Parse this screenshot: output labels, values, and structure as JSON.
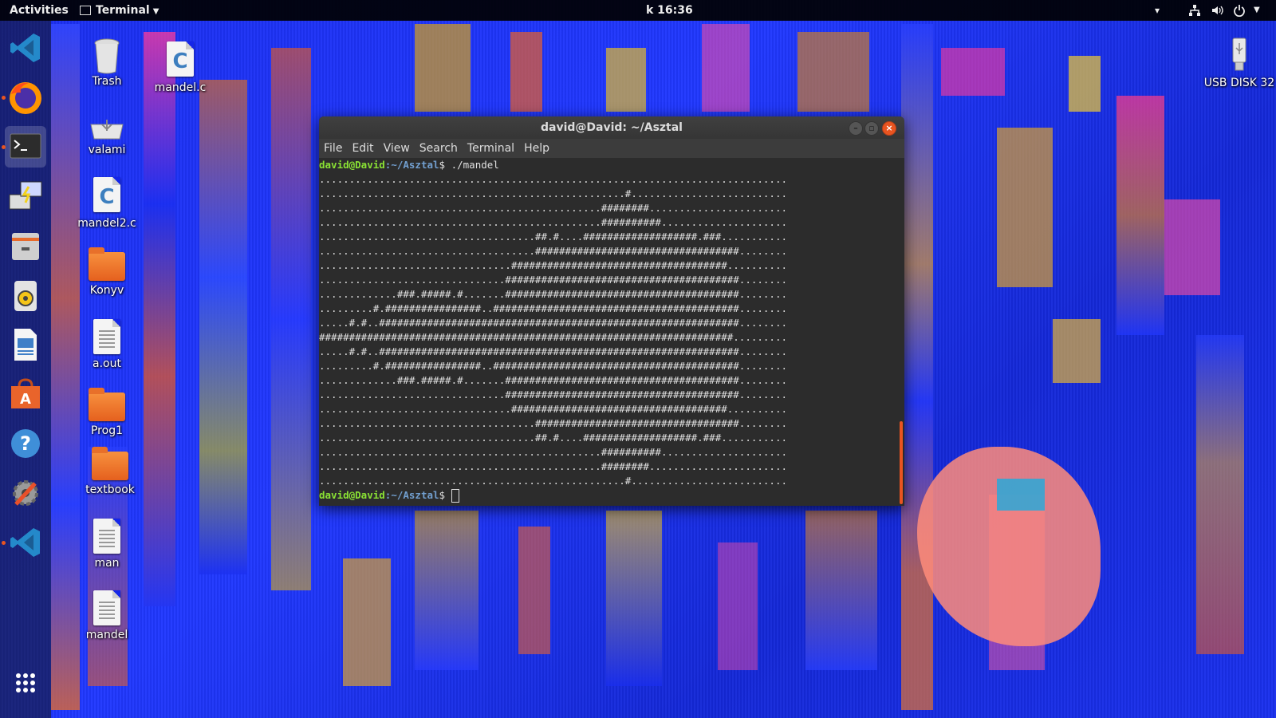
{
  "topbar": {
    "activities": "Activities",
    "app_menu": "Terminal",
    "clock": "k 16:36"
  },
  "dock": {
    "items": [
      {
        "name": "vscode"
      },
      {
        "name": "firefox"
      },
      {
        "name": "terminal"
      },
      {
        "name": "python-ide"
      },
      {
        "name": "file-manager"
      },
      {
        "name": "rhythmbox"
      },
      {
        "name": "libreoffice-writer"
      },
      {
        "name": "ubuntu-software"
      },
      {
        "name": "help"
      },
      {
        "name": "settings-tools"
      },
      {
        "name": "vscode-2"
      }
    ]
  },
  "desktop": {
    "icons": [
      {
        "label": "Trash",
        "type": "trash"
      },
      {
        "label": "mandel.c",
        "type": "c-file"
      },
      {
        "label": "valami",
        "type": "usb-drive"
      },
      {
        "label": "mandel2.c",
        "type": "c-file"
      },
      {
        "label": "Konyv",
        "type": "folder"
      },
      {
        "label": "a.out",
        "type": "file"
      },
      {
        "label": "Prog1",
        "type": "folder"
      },
      {
        "label": "textbook",
        "type": "folder"
      },
      {
        "label": "man",
        "type": "file"
      },
      {
        "label": "mandel",
        "type": "file"
      },
      {
        "label": "USB DISK 32",
        "type": "usb-drive"
      }
    ]
  },
  "terminal": {
    "title": "david@David: ~/Asztal",
    "menu": [
      "File",
      "Edit",
      "View",
      "Search",
      "Terminal",
      "Help"
    ],
    "prompt_user": "david@David",
    "prompt_path": ":~/Asztal",
    "prompt_symbol": "$",
    "command": " ./mandel",
    "output": [
      "..............................................................................",
      "...................................................#..........................",
      "...............................................########.......................",
      "...............................................##########.....................",
      "....................................##.#....###################.###...........",
      "....................................##################################........",
      "................................####################################..........",
      "...............................#######################################........",
      ".............###.#####.#.......#######################################........",
      ".........#.################..#########################################........",
      ".....#.#..############################################################........",
      "#####################################################################.........",
      ".....#.#..############################################################........",
      ".........#.################..#########################################........",
      ".............###.#####.#.......#######################################........",
      "...............................#######################################........",
      "................................####################################..........",
      "....................................##################################........",
      "....................................##.#....###################.###...........",
      "...............................................##########.....................",
      "...............................................########.......................",
      "...................................................#.........................."
    ]
  },
  "colors": {
    "accent": "#e95420",
    "prompt_user": "#8ae234",
    "prompt_path": "#729fcf"
  }
}
